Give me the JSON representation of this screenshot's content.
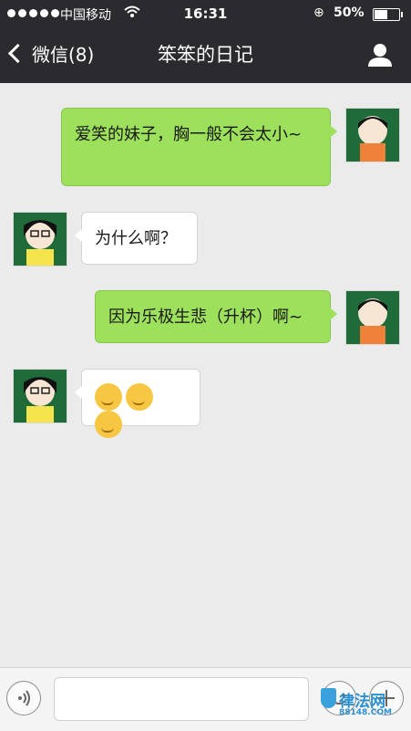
{
  "status_bar": {
    "carrier": "中国移动",
    "time": "16:31",
    "battery": "50%"
  },
  "nav": {
    "back_label": "微信(8)",
    "title": "笨笨的日记"
  },
  "messages": [
    {
      "side": "me",
      "text": "爱笑的妹子，胸一般不会太小~"
    },
    {
      "side": "other",
      "text": "为什么啊？"
    },
    {
      "side": "me",
      "text": "因为乐极生悲（升杯）啊~"
    },
    {
      "side": "other",
      "emoji_icons": [
        "grin-emoji-icon",
        "grin-emoji-icon",
        "grin-emoji-icon"
      ]
    }
  ],
  "watermark": {
    "text": "律法网",
    "sub": "88148.COM"
  },
  "colors": {
    "topbar": "#2a2a2f",
    "my_bubble": "#9de05b",
    "other_bubble": "#ffffff",
    "background": "#ebebeb"
  }
}
